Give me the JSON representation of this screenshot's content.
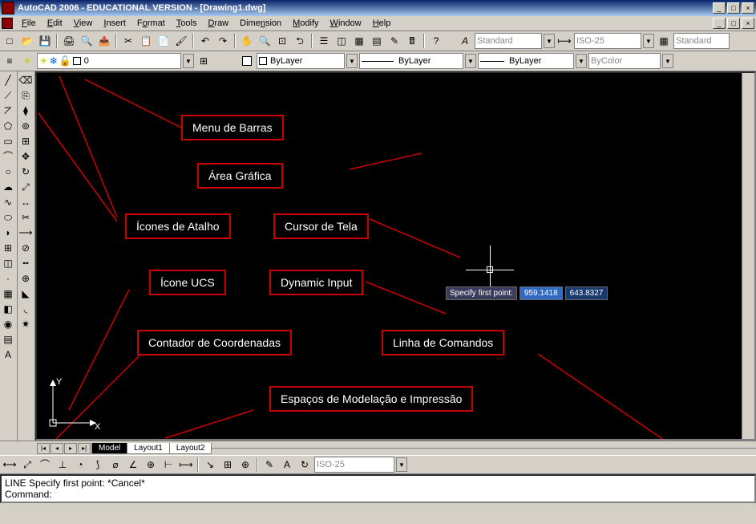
{
  "title": "AutoCAD 2006 - EDUCATIONAL VERSION - [Drawing1.dwg]",
  "menu": {
    "items": [
      {
        "label": "File",
        "u": "F"
      },
      {
        "label": "Edit",
        "u": "E"
      },
      {
        "label": "View",
        "u": "V"
      },
      {
        "label": "Insert",
        "u": "I"
      },
      {
        "label": "Format",
        "u": "o"
      },
      {
        "label": "Tools",
        "u": "T"
      },
      {
        "label": "Draw",
        "u": "D"
      },
      {
        "label": "Dimension",
        "u": "n"
      },
      {
        "label": "Modify",
        "u": "M"
      },
      {
        "label": "Window",
        "u": "W"
      },
      {
        "label": "Help",
        "u": "H"
      }
    ]
  },
  "toolbars": {
    "styles": {
      "textStyle": "Standard",
      "dimStyle": "ISO-25",
      "tableStyle": "Standard"
    },
    "layers": {
      "current": "0",
      "linetypeByLayer": "ByLayer",
      "lineweightByLayer": "ByLayer",
      "colorByLayer": "ByLayer",
      "plotStyle": "ByColor"
    }
  },
  "dynamicInput": {
    "prompt": "Specify first point:",
    "x": "959.1418",
    "y": "643.8327"
  },
  "ucs": {
    "xLabel": "X",
    "yLabel": "Y"
  },
  "layoutTabs": {
    "tabs": [
      "Model",
      "Layout1",
      "Layout2"
    ],
    "active": 0
  },
  "bottomCombo": "ISO-25",
  "commandLine": {
    "line1": "LINE Specify first point: *Cancel*",
    "line2": "Command:"
  },
  "annotations": {
    "menuDeBarras": "Menu de Barras",
    "areaGrafica": "Área Gráfica",
    "iconesAtalho": "Ícones de Atalho",
    "cursorDeTela": "Cursor de Tela",
    "iconeUCS": "Ícone UCS",
    "dynamicInput": "Dynamic Input",
    "contadorCoord": "Contador de Coordenadas",
    "linhaComandos": "Linha de Comandos",
    "espacosModel": "Espaços de Modelação e Impressão"
  },
  "winControls": {
    "min": "_",
    "max": "□",
    "close": "×"
  }
}
